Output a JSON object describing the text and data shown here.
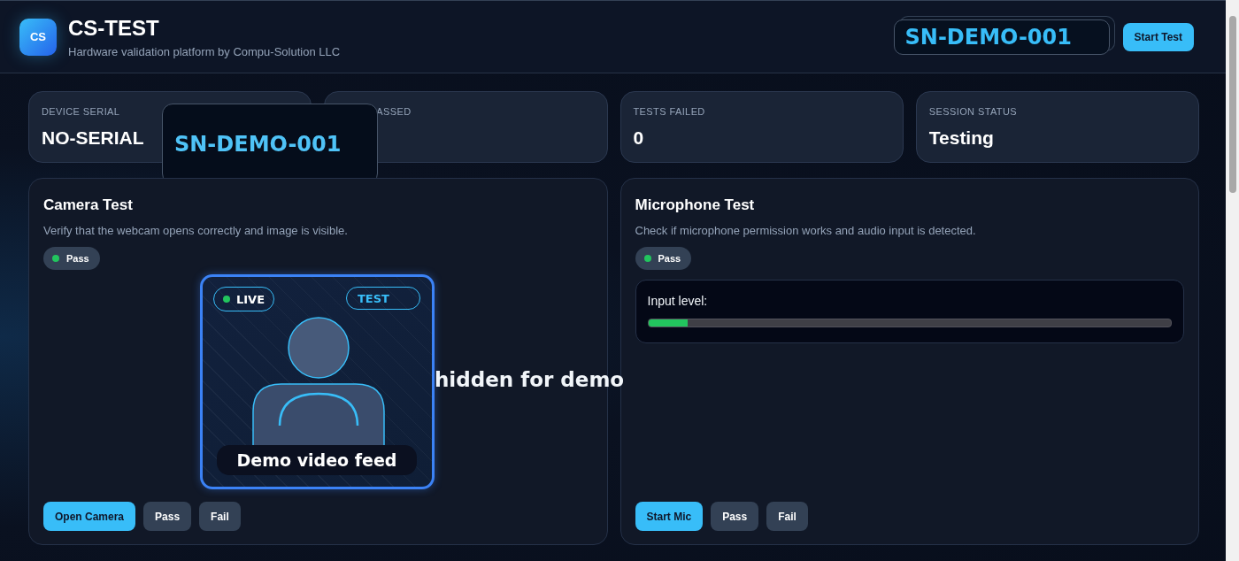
{
  "header": {
    "logo": "CS",
    "title": "CS-TEST",
    "subtitle": "Hardware validation platform by Compu-Solution LLC",
    "serial_field": {
      "value": "SN-DEMO-001"
    },
    "start_button": "Start Test"
  },
  "stats": [
    {
      "label": "DEVICE SERIAL",
      "value": "NO-SERIAL"
    },
    {
      "label": "ASSED"
    },
    {
      "label": "TESTS FAILED",
      "value": "0"
    },
    {
      "label": "SESSION STATUS",
      "value": "Testing"
    }
  ],
  "serial_popup": {
    "text": "SN-DEMO-001"
  },
  "tests": [
    {
      "kind": "camera",
      "title": "Camera Test",
      "description": "Verify that the webcam opens correctly and image is visible.",
      "status": "Pass",
      "video": {
        "live": "LIVE",
        "tag": "TEST",
        "caption": "Demo video feed"
      },
      "overlay_text": "hidden for demo",
      "buttons": [
        {
          "label": "Open Camera",
          "primary": true
        },
        {
          "label": "Pass",
          "primary": false
        },
        {
          "label": "Fail",
          "primary": false
        }
      ]
    },
    {
      "kind": "microphone",
      "title": "Microphone Test",
      "description": "Check if microphone permission works and audio input is detected.",
      "status": "Pass",
      "meter": {
        "label": "Input level:",
        "level": 0.075
      },
      "buttons": [
        {
          "label": "Start Mic",
          "primary": true
        },
        {
          "label": "Pass",
          "primary": false
        },
        {
          "label": "Fail",
          "primary": false
        }
      ]
    }
  ]
}
